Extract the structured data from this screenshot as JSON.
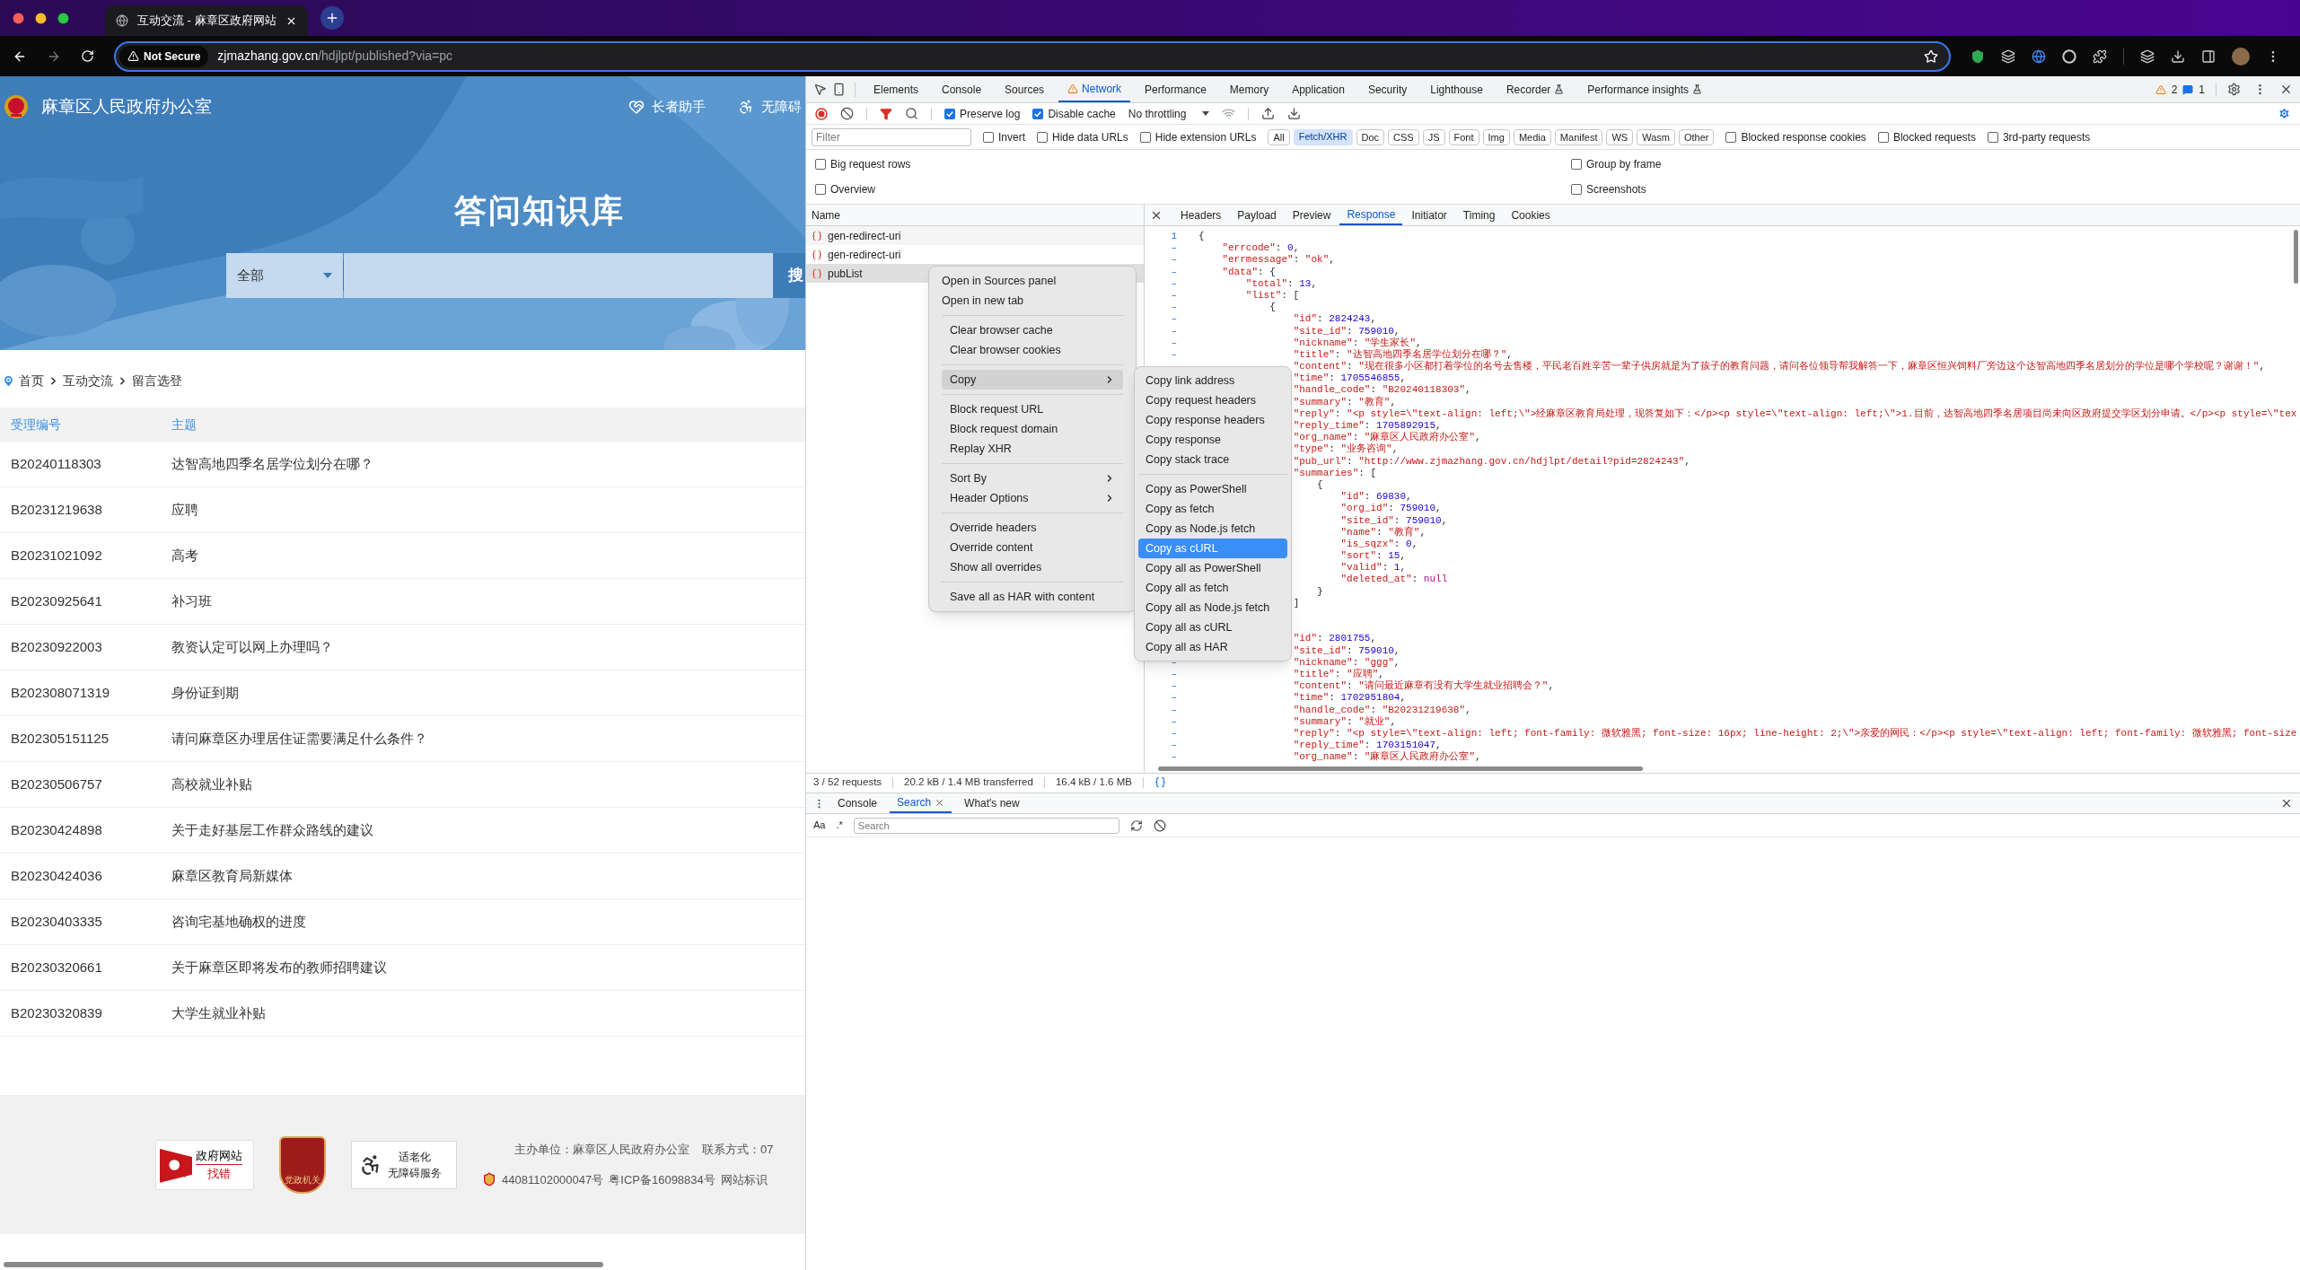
{
  "browser": {
    "tab_title": "互动交流 - 麻章区政府网站",
    "security_label": "Not Secure",
    "url_host": "zjmazhang.gov.cn",
    "url_path": "/hdjlpt/published?via=pc"
  },
  "page": {
    "site_title": "麻章区人民政府办公室",
    "header_links": [
      {
        "label": "长者助手",
        "kind": "elder"
      },
      {
        "label": "无障碍",
        "kind": "accessibility"
      }
    ],
    "banner_title": "答问知识库",
    "search": {
      "scope": "全部",
      "button": "搜"
    },
    "breadcrumb": [
      "首页",
      "互动交流",
      "留言选登"
    ],
    "table": {
      "columns": [
        "受理编号",
        "主题"
      ],
      "rows": [
        [
          "B20240118303",
          "达智高地四季名居学位划分在哪？"
        ],
        [
          "B20231219638",
          "应聘"
        ],
        [
          "B20231021092",
          "高考"
        ],
        [
          "B20230925641",
          "补习班"
        ],
        [
          "B20230922003",
          "教资认定可以网上办理吗？"
        ],
        [
          "B202308071319",
          "身份证到期"
        ],
        [
          "B202305151125",
          "请问麻章区办理居住证需要满足什么条件？"
        ],
        [
          "B20230506757",
          "高校就业补贴"
        ],
        [
          "B20230424898",
          "关于走好基层工作群众路线的建议"
        ],
        [
          "B20230424036",
          "麻章区教育局新媒体"
        ],
        [
          "B20230403335",
          "咨询宅基地确权的进度"
        ],
        [
          "B20230320661",
          "关于麻章区即将发布的教师招聘建议"
        ],
        [
          "B20230320839",
          "大学生就业补贴"
        ]
      ]
    },
    "footer": {
      "badges": [
        {
          "kind": "error",
          "lines": [
            "政府网站",
            "找错"
          ]
        },
        {
          "kind": "party",
          "lines": [
            "党政机关"
          ]
        },
        {
          "kind": "elder",
          "lines": [
            "适老化",
            "无障碍服务"
          ]
        }
      ],
      "sponsor": "主办单位：麻章区人民政府办公室",
      "contact": "联系方式：07",
      "record": "44081102000047号",
      "icp": "粤ICP备16098834号",
      "site_code": "网站标识"
    }
  },
  "devtools": {
    "tabs": [
      {
        "label": "Elements",
        "selected": false,
        "warning": false,
        "experimental": false
      },
      {
        "label": "Console",
        "selected": false,
        "warning": false,
        "experimental": false
      },
      {
        "label": "Sources",
        "selected": false,
        "warning": false,
        "experimental": false
      },
      {
        "label": "Network",
        "selected": true,
        "warning": true,
        "experimental": false
      },
      {
        "label": "Performance",
        "selected": false,
        "warning": false,
        "experimental": false
      },
      {
        "label": "Memory",
        "selected": false,
        "warning": false,
        "experimental": false
      },
      {
        "label": "Application",
        "selected": false,
        "warning": false,
        "experimental": false
      },
      {
        "label": "Security",
        "selected": false,
        "warning": false,
        "experimental": false
      },
      {
        "label": "Lighthouse",
        "selected": false,
        "warning": false,
        "experimental": false
      },
      {
        "label": "Recorder",
        "selected": false,
        "warning": false,
        "experimental": true
      },
      {
        "label": "Performance insights",
        "selected": false,
        "warning": false,
        "experimental": true
      }
    ],
    "issues": {
      "warnings": "2",
      "messages": "1"
    },
    "toolbar": {
      "checks": [
        {
          "label": "Preserve log",
          "checked": true
        },
        {
          "label": "Disable cache",
          "checked": true
        }
      ],
      "throttling": "No throttling"
    },
    "filter": {
      "placeholder": "Filter",
      "checks": [
        {
          "label": "Invert",
          "checked": false
        },
        {
          "label": "Hide data URLs",
          "checked": false
        },
        {
          "label": "Hide extension URLs",
          "checked": false
        }
      ],
      "types": [
        {
          "label": "All",
          "selected": false
        },
        {
          "label": "Fetch/XHR",
          "selected": true
        },
        {
          "label": "Doc",
          "selected": false
        },
        {
          "label": "CSS",
          "selected": false
        },
        {
          "label": "JS",
          "selected": false
        },
        {
          "label": "Font",
          "selected": false
        },
        {
          "label": "Img",
          "selected": false
        },
        {
          "label": "Media",
          "selected": false
        },
        {
          "label": "Manifest",
          "selected": false
        },
        {
          "label": "WS",
          "selected": false
        },
        {
          "label": "Wasm",
          "selected": false
        },
        {
          "label": "Other",
          "selected": false
        }
      ],
      "checks_after": [
        {
          "label": "Blocked response cookies",
          "checked": false
        },
        {
          "label": "Blocked requests",
          "checked": false
        },
        {
          "label": "3rd-party requests",
          "checked": false
        }
      ]
    },
    "options": [
      {
        "label": "Big request rows",
        "checked": false
      },
      {
        "label": "Group by frame",
        "checked": false
      },
      {
        "label": "Overview",
        "checked": false
      },
      {
        "label": "Screenshots",
        "checked": false
      }
    ],
    "requests": {
      "column": "Name",
      "rows": [
        {
          "name": "gen-redirect-uri",
          "selected": false
        },
        {
          "name": "gen-redirect-uri",
          "selected": false
        },
        {
          "name": "pubList",
          "selected": true
        }
      ]
    },
    "detail": {
      "tabs": [
        {
          "label": "Headers",
          "selected": false
        },
        {
          "label": "Payload",
          "selected": false
        },
        {
          "label": "Preview",
          "selected": false
        },
        {
          "label": "Response",
          "selected": true
        },
        {
          "label": "Initiator",
          "selected": false
        },
        {
          "label": "Timing",
          "selected": false
        },
        {
          "label": "Cookies",
          "selected": false
        }
      ],
      "lines": [
        {
          "gutter": "1",
          "text": "{"
        },
        {
          "gutter": "–",
          "text": "    \"errcode\": 0,"
        },
        {
          "gutter": "–",
          "text": "    \"errmessage\": \"ok\","
        },
        {
          "gutter": "–",
          "text": "    \"data\": {"
        },
        {
          "gutter": "–",
          "text": "        \"total\": 13,"
        },
        {
          "gutter": "–",
          "text": "        \"list\": ["
        },
        {
          "gutter": "–",
          "text": "            {"
        },
        {
          "gutter": "–",
          "text": "                \"id\": 2824243,"
        },
        {
          "gutter": "–",
          "text": "                \"site_id\": 759010,"
        },
        {
          "gutter": "–",
          "text": "                \"nickname\": \"学生家长\","
        },
        {
          "gutter": "–",
          "text": "                \"title\": \"达智高地四季名居学位划分在哪？\","
        },
        {
          "text": "                \"content\": \"现在很多小区都打着学位的名号去售楼，平民老百姓辛苦一辈子供房就是为了孩子的教育问题，请问各位领导帮我解答一下，麻章区恒兴饲料厂旁边这个达智高地四季名居划分的学位是哪个学校呢？谢谢！\","
        },
        {
          "text": "                \"time\": 1705546855,"
        },
        {
          "text": "                \"handle_code\": \"B20240118303\","
        },
        {
          "text": "                \"summary\": \"教育\","
        },
        {
          "text": "                \"reply\": \"<p style=\\\"text-align: left;\\\">经麻章区教育局处理，现答复如下：</p><p style=\\\"text-align: left;\\\">1.目前，达智高地四季名居项目尚未向区政府提交学区划分申请。</p><p style=\\\"tex"
        },
        {
          "text": "                \"reply_time\": 1705892915,"
        },
        {
          "text": "                \"org_name\": \"麻章区人民政府办公室\","
        },
        {
          "text": "                \"type\": \"业务咨询\","
        },
        {
          "text": "                \"pub_url\": \"http://www.zjmazhang.gov.cn/hdjlpt/detail?pid=2824243\","
        },
        {
          "text": "                \"summaries\": ["
        },
        {
          "text": "                    {"
        },
        {
          "text": "                        \"id\": 69830,"
        },
        {
          "text": "                        \"org_id\": 759010,"
        },
        {
          "text": "                        \"site_id\": 759010,"
        },
        {
          "text": "                        \"name\": \"教育\","
        },
        {
          "text": "                        \"is_sqzx\": 0,"
        },
        {
          "text": "                        \"sort\": 15,"
        },
        {
          "text": "                        \"valid\": 1,"
        },
        {
          "text": "                        \"deleted_at\": null"
        },
        {
          "text": "                    }"
        },
        {
          "text": "                ]"
        }
      ],
      "lines_after": [
        {
          "text": "                \"id\": 2801755,"
        },
        {
          "text": "                \"site_id\": 759010,"
        },
        {
          "gutter": "–",
          "text": "                \"nickname\": \"ggg\","
        },
        {
          "gutter": "–",
          "text": "                \"title\": \"应聘\","
        },
        {
          "gutter": "–",
          "text": "                \"content\": \"请问最近麻章有没有大学生就业招聘会？\","
        },
        {
          "gutter": "–",
          "text": "                \"time\": 1702951804,"
        },
        {
          "gutter": "–",
          "text": "                \"handle_code\": \"B20231219638\","
        },
        {
          "gutter": "–",
          "text": "                \"summary\": \"就业\","
        },
        {
          "gutter": "–",
          "text": "                \"reply\": \"<p style=\\\"text-align: left; font-family: 微软雅黑; font-size: 16px; line-height: 2;\\\">亲爱的网民：</p><p style=\\\"text-align: left; font-family: 微软雅黑; font-size"
        },
        {
          "gutter": "–",
          "text": "                \"reply_time\": 1703151047,"
        },
        {
          "gutter": "–",
          "text": "                \"org_name\": \"麻章区人民政府办公室\","
        }
      ]
    },
    "status": [
      "3 / 52 requests",
      "20.2 kB / 1.4 MB transferred",
      "16.4 kB / 1.6 MB"
    ],
    "drawer": {
      "tabs": [
        {
          "label": "Console",
          "selected": false
        },
        {
          "label": "Search",
          "selected": true
        },
        {
          "label": "What's new",
          "selected": false
        }
      ],
      "case_label": "Aa",
      "regex_label": ".*",
      "placeholder": "Search"
    },
    "context_menu": {
      "groups": [
        [
          {
            "label": "Open in Sources panel",
            "selected": false,
            "submenu": false
          },
          {
            "label": "Open in new tab",
            "selected": false,
            "submenu": false
          }
        ],
        [
          {
            "label": "Clear browser cache",
            "selected": false,
            "submenu": false
          },
          {
            "label": "Clear browser cookies",
            "selected": false,
            "submenu": false
          }
        ],
        [
          {
            "label": "Copy",
            "selected": true,
            "submenu": true
          }
        ],
        [
          {
            "label": "Block request URL",
            "selected": false,
            "submenu": false
          },
          {
            "label": "Block request domain",
            "selected": false,
            "submenu": false
          },
          {
            "label": "Replay XHR",
            "selected": false,
            "submenu": false
          }
        ],
        [
          {
            "label": "Sort By",
            "selected": false,
            "submenu": true
          },
          {
            "label": "Header Options",
            "selected": false,
            "submenu": true
          }
        ],
        [
          {
            "label": "Override headers",
            "selected": false,
            "submenu": false
          },
          {
            "label": "Override content",
            "selected": false,
            "submenu": false
          },
          {
            "label": "Show all overrides",
            "selected": false,
            "submenu": false
          }
        ],
        [
          {
            "label": "Save all as HAR with content",
            "selected": false,
            "submenu": false
          }
        ]
      ]
    },
    "copy_submenu": {
      "groups": [
        [
          {
            "label": "Copy link address",
            "selected": false
          },
          {
            "label": "Copy request headers",
            "selected": false
          },
          {
            "label": "Copy response headers",
            "selected": false
          },
          {
            "label": "Copy response",
            "selected": false
          },
          {
            "label": "Copy stack trace",
            "selected": false
          }
        ],
        [
          {
            "label": "Copy as PowerShell",
            "selected": false
          },
          {
            "label": "Copy as fetch",
            "selected": false
          },
          {
            "label": "Copy as Node.js fetch",
            "selected": false
          },
          {
            "label": "Copy as cURL",
            "selected": true
          },
          {
            "label": "Copy all as PowerShell",
            "selected": false
          },
          {
            "label": "Copy all as fetch",
            "selected": false
          },
          {
            "label": "Copy all as Node.js fetch",
            "selected": false
          },
          {
            "label": "Copy all as cURL",
            "selected": false
          },
          {
            "label": "Copy all as HAR",
            "selected": false
          }
        ]
      ]
    }
  }
}
